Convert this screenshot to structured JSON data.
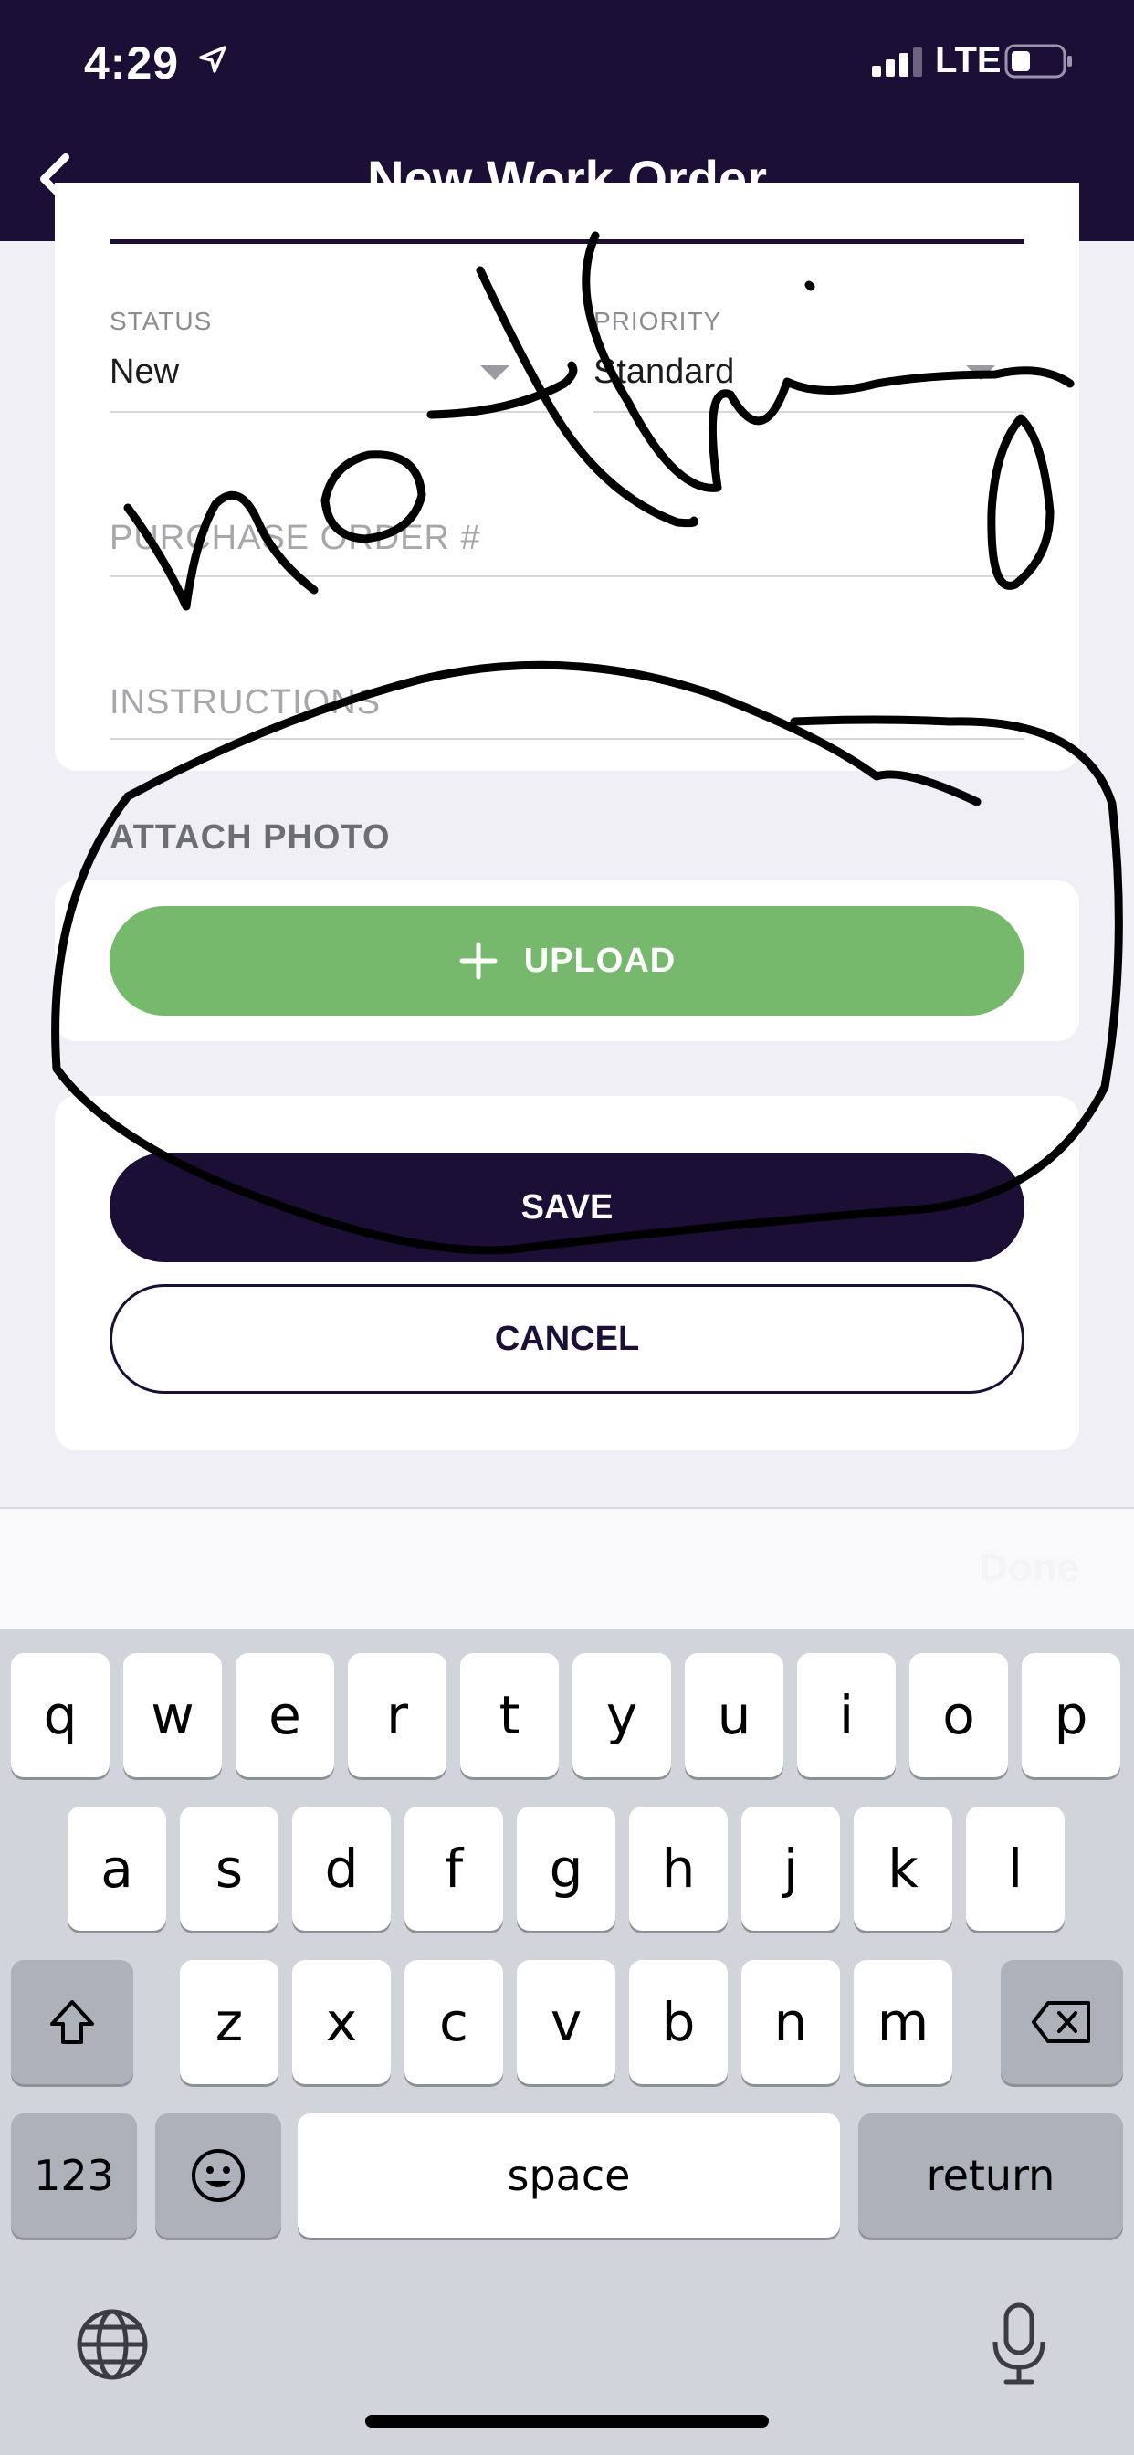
{
  "status_bar": {
    "time": "4:29",
    "network": "LTE"
  },
  "header": {
    "title": "New Work Order"
  },
  "form": {
    "status": {
      "label": "STATUS",
      "value": "New"
    },
    "priority": {
      "label": "PRIORITY",
      "value": "Standard"
    },
    "purchase_order": {
      "placeholder": "PURCHASE ORDER #"
    },
    "instructions": {
      "placeholder": "INSTRUCTIONS"
    }
  },
  "attach": {
    "title": "ATTACH PHOTO",
    "upload_label": "UPLOAD"
  },
  "actions": {
    "save_label": "SAVE",
    "cancel_label": "CANCEL"
  },
  "keyboard_accessory": {
    "done_label": "Done"
  },
  "keyboard": {
    "row1": [
      "q",
      "w",
      "e",
      "r",
      "t",
      "y",
      "u",
      "i",
      "o",
      "p"
    ],
    "row2": [
      "a",
      "s",
      "d",
      "f",
      "g",
      "h",
      "j",
      "k",
      "l"
    ],
    "row3": [
      "z",
      "x",
      "c",
      "v",
      "b",
      "n",
      "m"
    ],
    "numbers_label": "123",
    "space_label": "space",
    "return_label": "return"
  },
  "colors": {
    "primary": "#1b0f35",
    "upload_green": "#76b96c"
  },
  "icons": [
    "back-arrow-icon",
    "location-arrow-icon",
    "signal-icon",
    "battery-icon",
    "plus-icon",
    "shift-icon",
    "backspace-icon",
    "emoji-icon",
    "globe-icon",
    "microphone-icon"
  ]
}
